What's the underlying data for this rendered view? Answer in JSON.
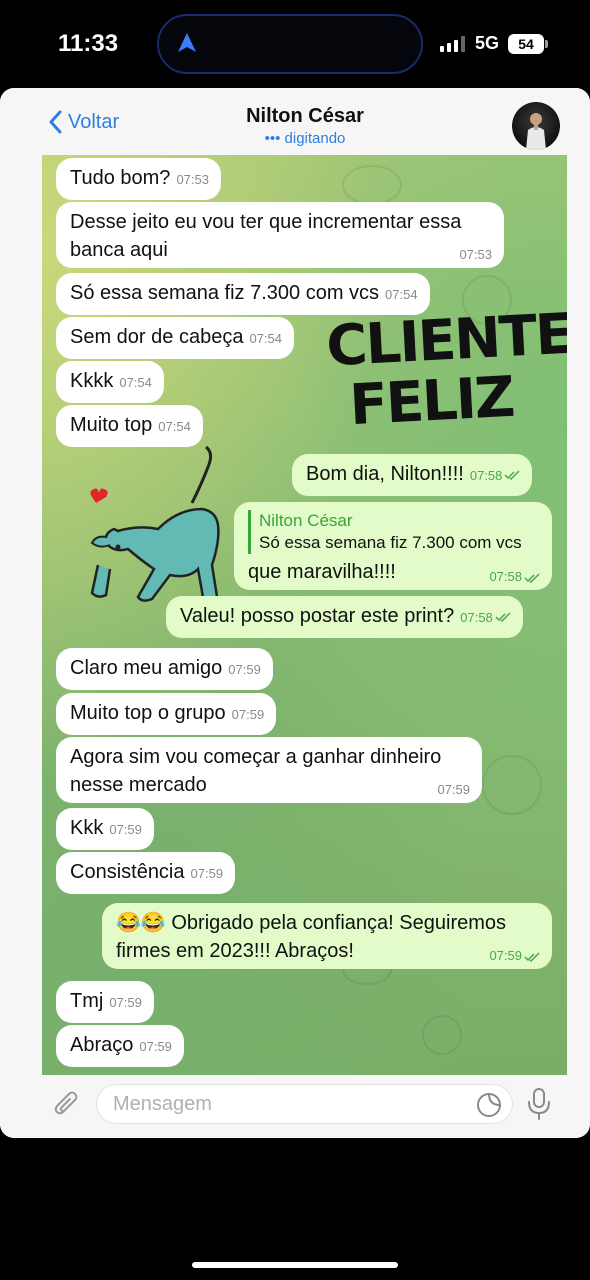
{
  "status_bar": {
    "time": "11:33",
    "network": "5G",
    "battery": "54"
  },
  "header": {
    "back_label": "Voltar",
    "contact_name": "Nilton César",
    "contact_status": "••• digitando"
  },
  "sticker": {
    "line1": "CLIENTE",
    "line2": "FELIZ"
  },
  "messages": [
    {
      "dir": "in",
      "text": "Tudo bom?",
      "time": "07:53"
    },
    {
      "dir": "in",
      "text": "Desse jeito eu vou ter que incrementar essa banca aqui",
      "time": "07:53"
    },
    {
      "dir": "in",
      "text": "Só essa semana fiz 7.300 com vcs",
      "time": "07:54"
    },
    {
      "dir": "in",
      "text": "Sem dor de cabeça",
      "time": "07:54"
    },
    {
      "dir": "in",
      "text": "Kkkk",
      "time": "07:54"
    },
    {
      "dir": "in",
      "text": "Muito top",
      "time": "07:54"
    },
    {
      "dir": "out",
      "text": "Bom dia, Nilton!!!!",
      "time": "07:58"
    },
    {
      "dir": "out",
      "text": "que maravilha!!!!",
      "time": "07:58",
      "reply_name": "Nilton César",
      "reply_text": "Só essa semana fiz 7.300 com vcs"
    },
    {
      "dir": "out",
      "text": "Valeu! posso postar este print?",
      "time": "07:58"
    },
    {
      "dir": "in",
      "text": "Claro meu amigo",
      "time": "07:59"
    },
    {
      "dir": "in",
      "text": "Muito top o grupo",
      "time": "07:59"
    },
    {
      "dir": "in",
      "text": "Agora sim vou começar a ganhar dinheiro nesse mercado",
      "time": "07:59"
    },
    {
      "dir": "in",
      "text": "Kkk",
      "time": "07:59"
    },
    {
      "dir": "in",
      "text": "Consistência",
      "time": "07:59"
    },
    {
      "dir": "out",
      "text": "😂😂 Obrigado pela confiança! Seguiremos firmes em 2023!!! Abraços!",
      "time": "07:59"
    },
    {
      "dir": "in",
      "text": "Tmj",
      "time": "07:59"
    },
    {
      "dir": "in",
      "text": "Abraço",
      "time": "07:59"
    }
  ],
  "input": {
    "placeholder": "Mensagem"
  },
  "colors": {
    "accent": "#2f7fe0",
    "outgoing_bubble": "#e2fbc9",
    "incoming_bubble": "#ffffff",
    "read_ticks": "#4ca64c"
  },
  "icons": [
    "navigation-arrow-icon",
    "signal-icon",
    "back-chevron-icon",
    "attach-icon",
    "sticker-icon",
    "mic-icon"
  ]
}
